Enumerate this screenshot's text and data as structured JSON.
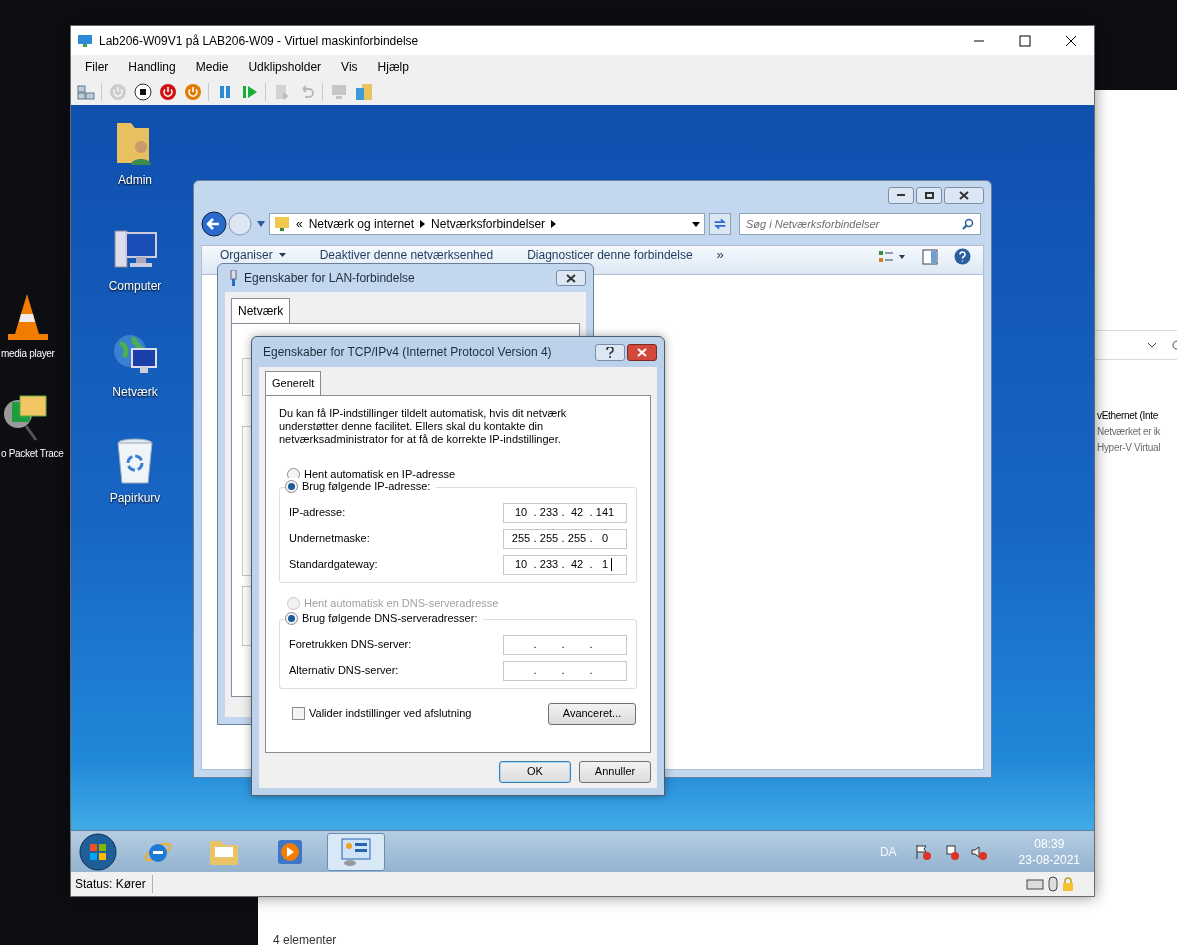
{
  "host_desktop": {
    "shortcuts": [
      {
        "kind": "cone",
        "label": "media player"
      },
      {
        "kind": "tracer",
        "label": "o Packet Trace"
      }
    ]
  },
  "background_explorer": {
    "items": [
      "vEthernet (Inte",
      "Netværket er ik",
      "Hyper-V Virtual"
    ],
    "status": "4 elementer"
  },
  "vm_window": {
    "title": "Lab206-W09V1 på LAB206-W09 - Virtuel maskinforbindelse",
    "menu": [
      "Filer",
      "Handling",
      "Medie",
      "Udklipsholder",
      "Vis",
      "Hjælp"
    ],
    "toolbar": [
      {
        "kind": "ctrl-alt-del",
        "disabled": false
      },
      {
        "kind": "power",
        "disabled": true
      },
      {
        "kind": "stop",
        "disabled": false
      },
      {
        "kind": "power-red",
        "disabled": false
      },
      {
        "kind": "power-orange",
        "disabled": false
      },
      {
        "kind": "pause",
        "disabled": false
      },
      {
        "kind": "play",
        "disabled": false
      },
      {
        "kind": "snapshot",
        "disabled": true
      },
      {
        "kind": "revert",
        "disabled": true
      },
      {
        "kind": "monitor",
        "disabled": true
      },
      {
        "kind": "share",
        "disabled": false
      }
    ],
    "status": "Status: Kører"
  },
  "guest_desktop": {
    "icons": [
      {
        "kind": "user-folder",
        "label": "Admin"
      },
      {
        "kind": "computer",
        "label": "Computer"
      },
      {
        "kind": "network",
        "label": "Netværk"
      },
      {
        "kind": "bin",
        "label": "Papirkurv"
      }
    ]
  },
  "explorer": {
    "breadcrumb_prefix": "«",
    "breadcrumb": [
      "Netværk og internet",
      "Netværksforbindelser"
    ],
    "search_placeholder": "Søg i Netværksforbindelser",
    "commands": [
      "Organiser",
      "Deaktiver denne netværksenhed",
      "Diagnosticer denne forbindelse"
    ],
    "more": "»"
  },
  "lan_dialog": {
    "title": "Egenskaber for LAN-forbindelse",
    "tabs": [
      {
        "label": "Netværk",
        "selected": true
      }
    ]
  },
  "tcp_dialog": {
    "title": "Egenskaber for TCP/IPv4 (Internet Protocol Version 4)",
    "tabs": [
      {
        "label": "Generelt",
        "selected": true
      }
    ],
    "intro": "Du kan få IP-indstillinger tildelt automatisk, hvis dit netværk understøtter denne facilitet. Ellers skal du kontakte din netværksadministrator for at få de korrekte IP-indstillinger.",
    "ip_options": [
      {
        "label": "Hent automatisk en IP-adresse",
        "selected": false,
        "disabled": false
      },
      {
        "label": "Brug følgende IP-adresse:",
        "selected": true,
        "disabled": false
      }
    ],
    "ip_fields": [
      {
        "label": "IP-adresse:",
        "octets": [
          "10",
          "233",
          "42",
          "141"
        ],
        "separators": [
          ".",
          ".",
          "."
        ]
      },
      {
        "label": "Undernetmaske:",
        "octets": [
          "255",
          "255",
          "255",
          "0"
        ],
        "separators": [
          ".",
          ".",
          "."
        ]
      },
      {
        "label": "Standardgateway:",
        "octets": [
          "10",
          "233",
          "42",
          "1"
        ],
        "separators": [
          ".",
          ".",
          "."
        ],
        "focused": true
      }
    ],
    "dns_options": [
      {
        "label": "Hent automatisk en DNS-serveradresse",
        "selected": false,
        "disabled": true
      },
      {
        "label": "Brug følgende DNS-serveradresser:",
        "selected": true,
        "disabled": false
      }
    ],
    "dns_fields": [
      {
        "label": "Foretrukken DNS-server:",
        "separators": [
          ".",
          ".",
          "."
        ]
      },
      {
        "label": "Alternativ DNS-server:",
        "separators": [
          ".",
          ".",
          "."
        ]
      }
    ],
    "validate": {
      "label": "Valider indstillinger ved afslutning",
      "checked": false
    },
    "advanced": "Avanceret...",
    "buttons": [
      {
        "label": "OK",
        "default": true
      },
      {
        "label": "Annuller",
        "default": false
      }
    ]
  },
  "taskbar": {
    "apps": [
      {
        "kind": "ie",
        "selected": false
      },
      {
        "kind": "folder",
        "selected": false
      },
      {
        "kind": "media",
        "selected": false
      },
      {
        "kind": "control-panel",
        "selected": true
      }
    ],
    "language": "DA",
    "time": "08:39",
    "date": "23-08-2021"
  }
}
